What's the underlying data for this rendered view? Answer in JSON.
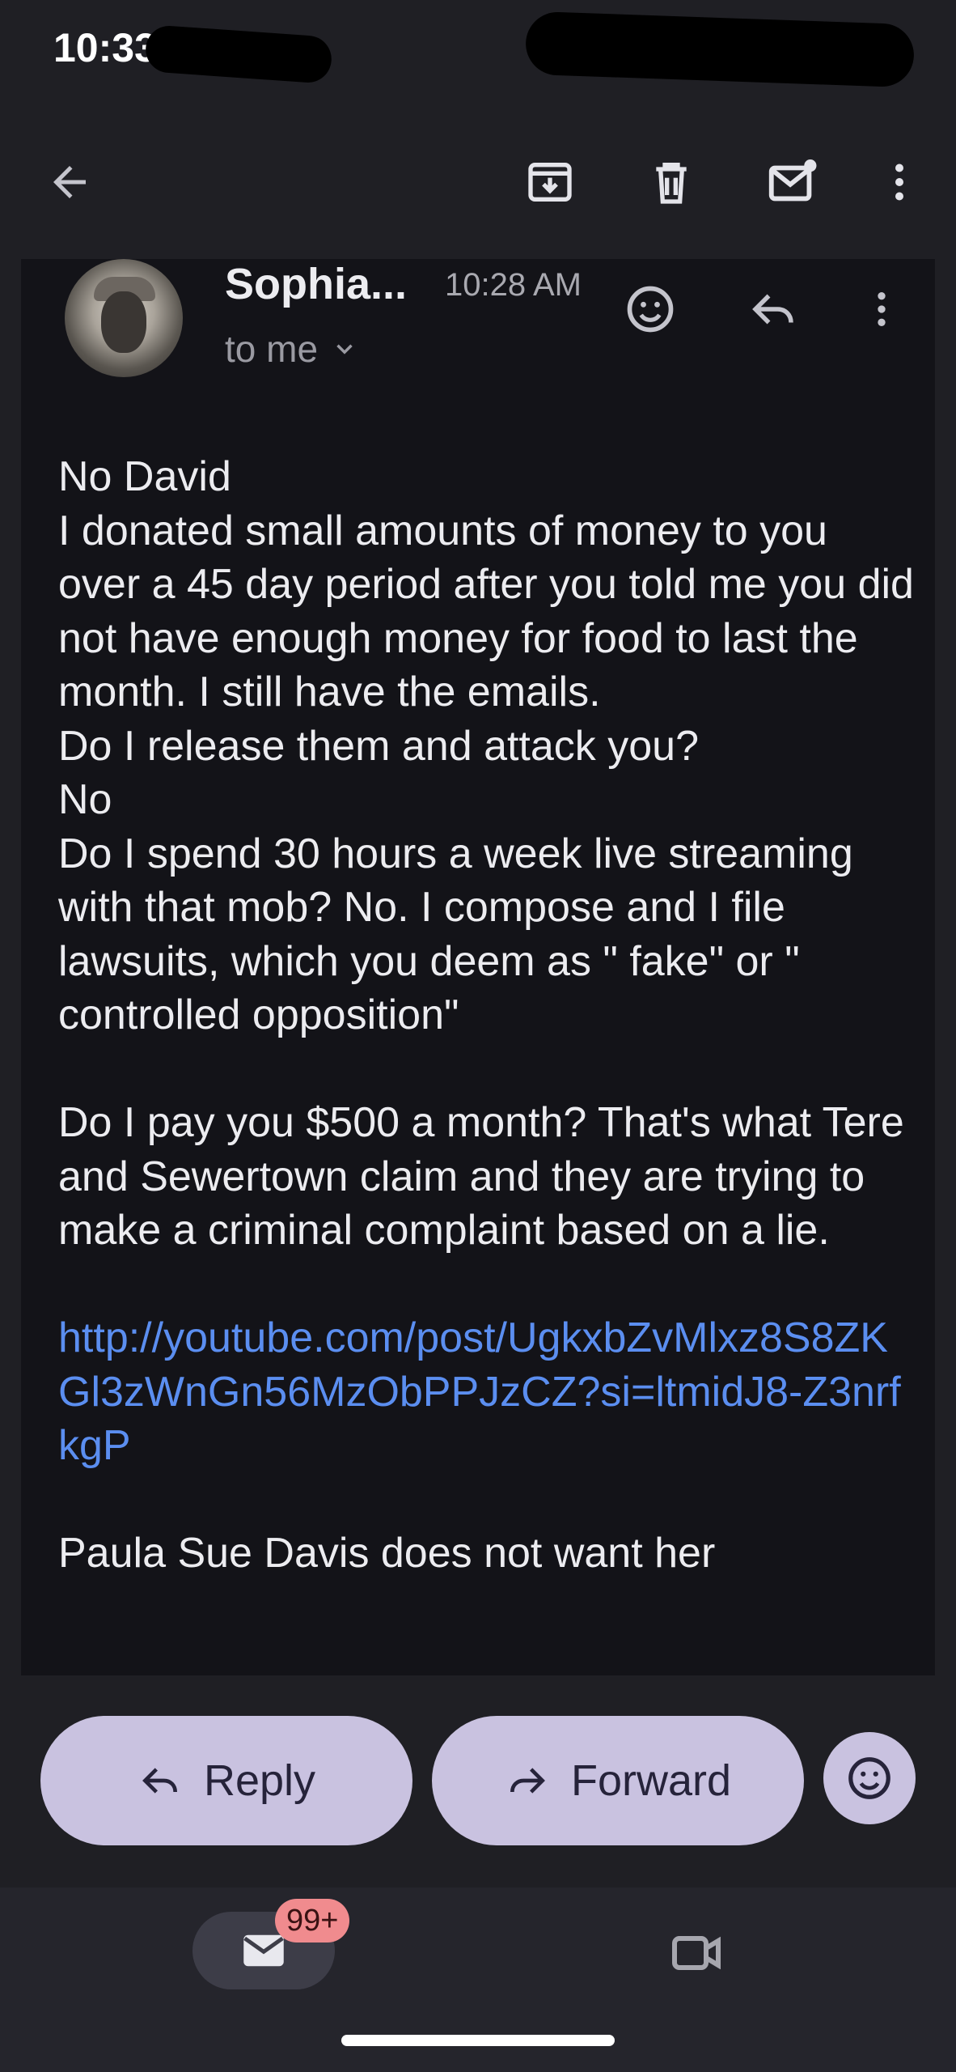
{
  "status": {
    "time": "10:33"
  },
  "toolbar": {
    "back_icon": "arrow-left-icon",
    "archive_icon": "archive-icon",
    "delete_icon": "trash-icon",
    "mark_unread_icon": "mail-unread-icon",
    "more_icon": "more-vert-icon"
  },
  "email": {
    "sender": "Sophia...",
    "time": "10:28 AM",
    "recipient_label": "to me",
    "body_paragraphs": [
      "No David\nI donated small amounts of money to you over a 45 day period after you told me you did not have enough money for food to last the month. I still have the emails.\nDo I release them and attack you?\nNo\nDo I spend 30 hours a week live streaming with that mob? No. I compose and I file lawsuits, which you deem as \" fake\" or \" controlled opposition\"",
      "Do I pay you $500 a month? That's what Tere and Sewertown claim and they are trying to make a criminal complaint based on a lie."
    ],
    "link": "http://youtube.com/post/UgkxbZvMlxz8S8ZKGl3zWnGn56MzObPPJzCZ?si=ltmidJ8-Z3nrfkgP",
    "body_tail": "Paula Sue Davis does not want her"
  },
  "actions": {
    "reply_label": "Reply",
    "forward_label": "Forward"
  },
  "nav": {
    "mail_badge": "99+"
  },
  "colors": {
    "background": "#1f1f24",
    "card": "#131318",
    "pill": "#c9c2e0",
    "link": "#5b8ef0",
    "badge": "#f08b8e"
  }
}
